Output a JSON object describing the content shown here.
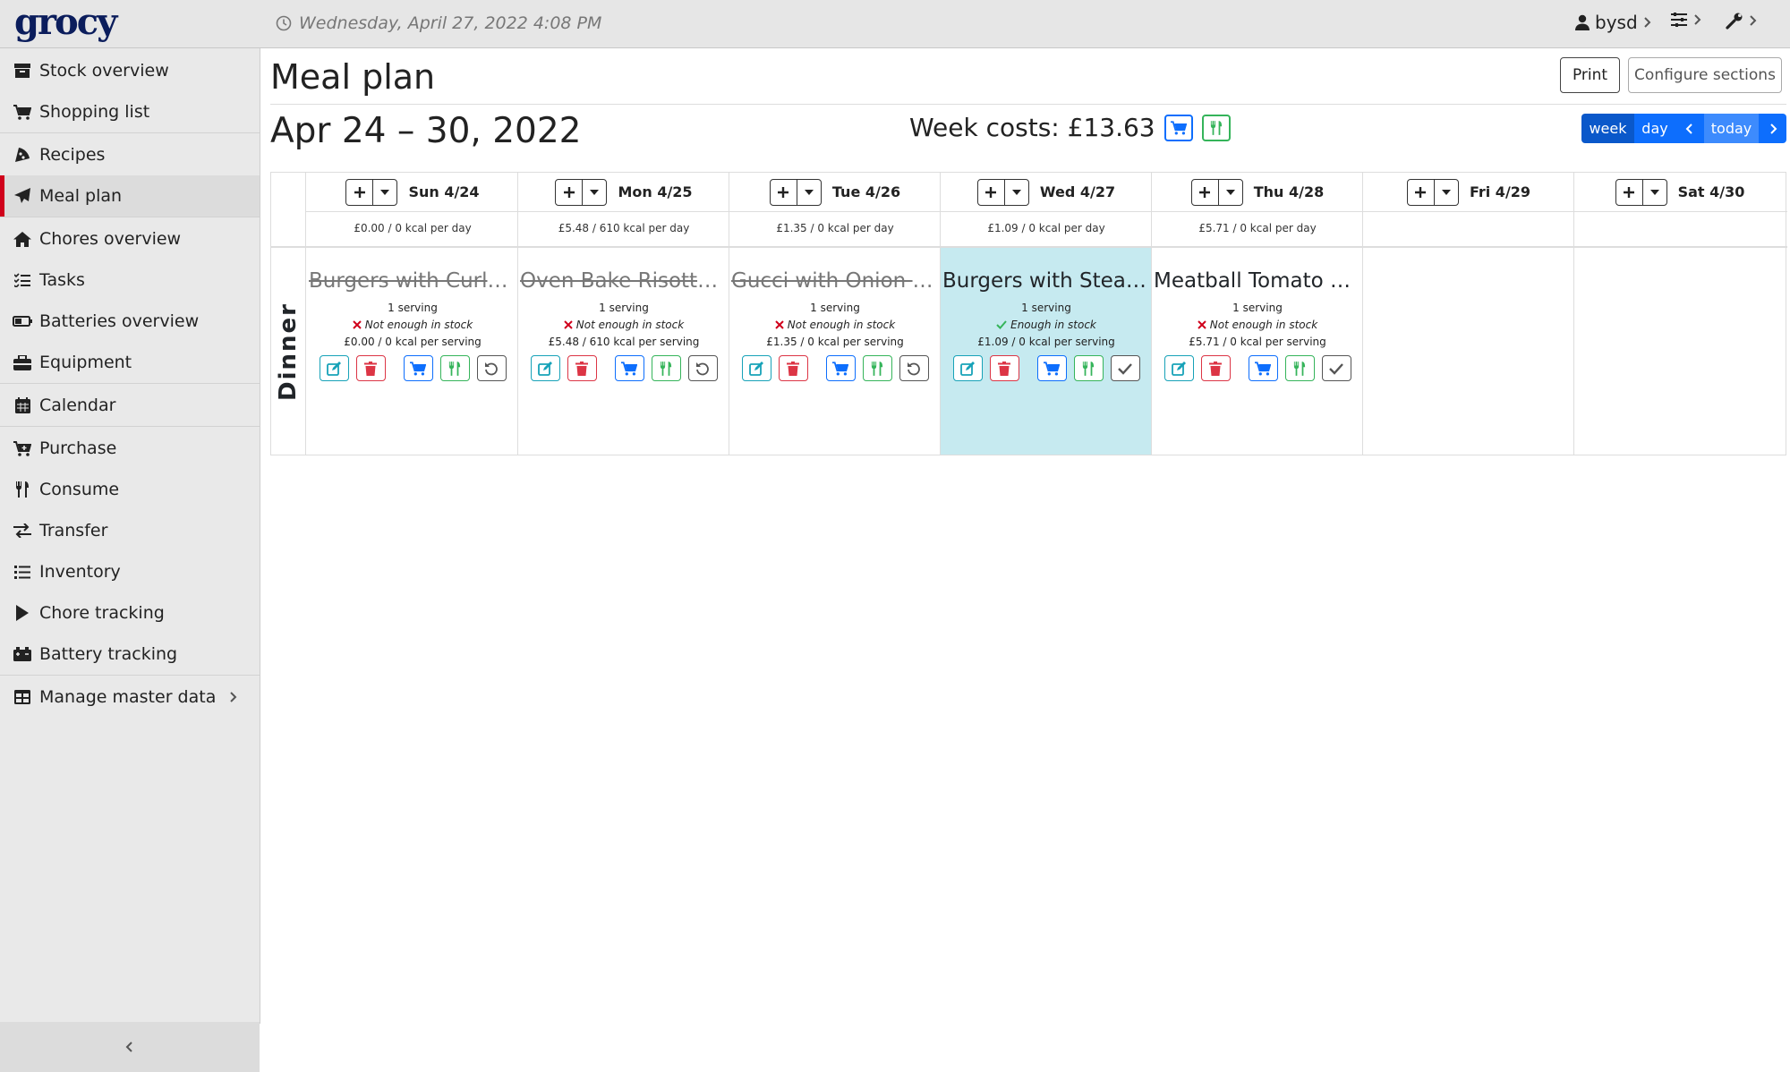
{
  "topbar": {
    "logo": "grocy",
    "datetime": "Wednesday, April 27, 2022 4:08 PM",
    "user": "bysd"
  },
  "sidebar": {
    "items": [
      {
        "label": "Stock overview",
        "icon": "box-icon"
      },
      {
        "label": "Shopping list",
        "icon": "cart-icon"
      },
      {
        "label": "Recipes",
        "icon": "pizza-icon"
      },
      {
        "label": "Meal plan",
        "icon": "paper-plane-icon",
        "active": true
      },
      {
        "label": "Chores overview",
        "icon": "home-icon"
      },
      {
        "label": "Tasks",
        "icon": "tasks-icon"
      },
      {
        "label": "Batteries overview",
        "icon": "battery-icon"
      },
      {
        "label": "Equipment",
        "icon": "toolbox-icon"
      },
      {
        "label": "Calendar",
        "icon": "calendar-icon"
      },
      {
        "label": "Purchase",
        "icon": "cart-plus-icon"
      },
      {
        "label": "Consume",
        "icon": "utensils-icon"
      },
      {
        "label": "Transfer",
        "icon": "exchange-icon"
      },
      {
        "label": "Inventory",
        "icon": "list-icon"
      },
      {
        "label": "Chore tracking",
        "icon": "play-icon"
      },
      {
        "label": "Battery tracking",
        "icon": "car-battery-icon"
      },
      {
        "label": "Manage master data",
        "icon": "table-icon"
      }
    ]
  },
  "page": {
    "title": "Meal plan",
    "print_label": "Print",
    "configure_label": "Configure sections",
    "range": "Apr 24 – 30, 2022",
    "week_costs": "Week costs: £13.63",
    "view": {
      "week": "week",
      "day": "day",
      "today": "today"
    }
  },
  "section": "Dinner",
  "days": [
    {
      "name": "Sun 4/24",
      "cost": "£0.00 / 0 kcal per day",
      "recipe": {
        "title": "Burgers with Curly Fries",
        "servings": "1 serving",
        "stock": "Not enough in stock",
        "enough": false,
        "cost": "£0.00 / 0 kcal per serving",
        "done": true
      }
    },
    {
      "name": "Mon 4/25",
      "cost": "£5.48 / 610 kcal per day",
      "recipe": {
        "title": "Oven Bake Risotto (Vegetarian)",
        "servings": "1 serving",
        "stock": "Not enough in stock",
        "enough": false,
        "cost": "£5.48 / 610 kcal per serving",
        "done": true
      }
    },
    {
      "name": "Tue 4/26",
      "cost": "£1.35 / 0 kcal per day",
      "recipe": {
        "title": "Gucci with Onion and Herbs",
        "servings": "1 serving",
        "stock": "Not enough in stock",
        "enough": false,
        "cost": "£1.35 / 0 kcal per serving",
        "done": true
      }
    },
    {
      "name": "Wed 4/27",
      "cost": "£1.09 / 0 kcal per day",
      "today": true,
      "recipe": {
        "title": "Burgers with Steak Fries",
        "servings": "1 serving",
        "stock": "Enough in stock",
        "enough": true,
        "cost": "£1.09 / 0 kcal per serving",
        "done": false
      }
    },
    {
      "name": "Thu 4/28",
      "cost": "£5.71 / 0 kcal per day",
      "recipe": {
        "title": "Meatball Tomato Spaghetti",
        "servings": "1 serving",
        "stock": "Not enough in stock",
        "enough": false,
        "cost": "£5.71 / 0 kcal per serving",
        "done": false
      }
    },
    {
      "name": "Fri 4/29",
      "cost": "",
      "recipe": null
    },
    {
      "name": "Sat 4/30",
      "cost": "",
      "recipe": null
    }
  ],
  "colors": {
    "accent": "#0d6efd",
    "today_bg": "#c6eaf0",
    "active_marker": "#d0011b",
    "danger": "#dc3545",
    "success": "#35b45a",
    "info": "#17a2b8"
  }
}
